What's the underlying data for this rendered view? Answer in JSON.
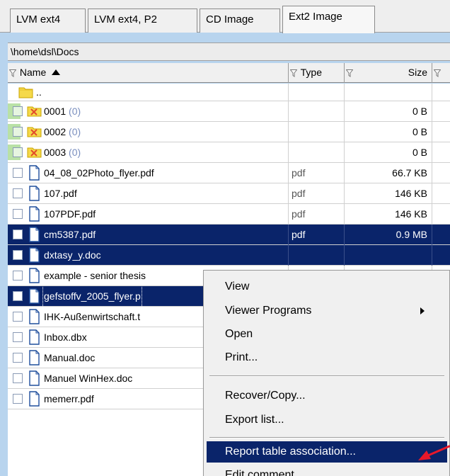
{
  "tabs": [
    {
      "label": "LVM ext4"
    },
    {
      "label": "LVM ext4, P2"
    },
    {
      "label": "CD Image"
    },
    {
      "label": "Ext2 Image"
    }
  ],
  "path": "\\home\\dsl\\Docs",
  "columns": {
    "name": "Name",
    "type": "Type",
    "size": "Size"
  },
  "rows": [
    {
      "name": "..",
      "type": "",
      "size": "",
      "count": ""
    },
    {
      "name": "0001",
      "type": "",
      "size": "0 B",
      "count": "(0)"
    },
    {
      "name": "0002",
      "type": "",
      "size": "0 B",
      "count": "(0)"
    },
    {
      "name": "0003",
      "type": "",
      "size": "0 B",
      "count": "(0)"
    },
    {
      "name": "04_08_02Photo_flyer.pdf",
      "type": "pdf",
      "size": "66.7 KB",
      "count": ""
    },
    {
      "name": "107.pdf",
      "type": "pdf",
      "size": "146 KB",
      "count": ""
    },
    {
      "name": "107PDF.pdf",
      "type": "pdf",
      "size": "146 KB",
      "count": ""
    },
    {
      "name": "cm5387.pdf",
      "type": "pdf",
      "size": "0.9 MB",
      "count": ""
    },
    {
      "name": "dxtasy_y.doc",
      "type": "",
      "size": "",
      "count": ""
    },
    {
      "name": "example - senior thesis",
      "type": "",
      "size": "",
      "count": ""
    },
    {
      "name": "gefstoffv_2005_flyer.p",
      "type": "",
      "size": "",
      "count": ""
    },
    {
      "name": "IHK-Außenwirtschaft.t",
      "type": "",
      "size": "",
      "count": ""
    },
    {
      "name": "Inbox.dbx",
      "type": "",
      "size": "",
      "count": ""
    },
    {
      "name": "Manual.doc",
      "type": "",
      "size": "",
      "count": ""
    },
    {
      "name": "Manuel WinHex.doc",
      "type": "",
      "size": "",
      "count": ""
    },
    {
      "name": "memerr.pdf",
      "type": "",
      "size": "",
      "count": ""
    }
  ],
  "menu": {
    "items": [
      {
        "label": "View"
      },
      {
        "label": "Viewer Programs"
      },
      {
        "label": "Open"
      },
      {
        "label": "Print..."
      },
      {
        "label": "Recover/Copy..."
      },
      {
        "label": "Export list..."
      },
      {
        "label": "Report table association..."
      },
      {
        "label": "Edit comment..."
      }
    ]
  },
  "colors": {
    "selection": "#0a246a",
    "background": "#b8d4ee",
    "annotation": "#e8182a"
  },
  "icons": {
    "folder": "folder-icon",
    "deleted_folder": "deleted-folder-icon",
    "document": "document-icon",
    "filter": "filter-icon",
    "sort_ascending": "sort-ascending-icon",
    "submenu": "submenu-arrow-icon",
    "annotation": "red-arrow-icon"
  }
}
